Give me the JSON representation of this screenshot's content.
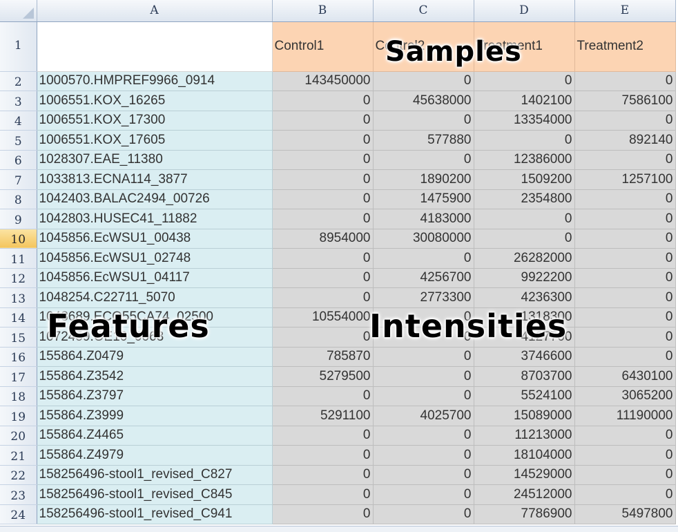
{
  "columns": [
    "A",
    "B",
    "C",
    "D",
    "E"
  ],
  "header_row": {
    "number": "1",
    "a": "",
    "labels": [
      "Control1",
      "Control2",
      "Treatment1",
      "Treatment2"
    ]
  },
  "rows": [
    {
      "n": "2",
      "feature": "1000570.HMPREF9966_0914",
      "vals": [
        "143450000",
        "0",
        "0",
        "0"
      ]
    },
    {
      "n": "3",
      "feature": "1006551.KOX_16265",
      "vals": [
        "0",
        "45638000",
        "1402100",
        "7586100"
      ]
    },
    {
      "n": "4",
      "feature": "1006551.KOX_17300",
      "vals": [
        "0",
        "0",
        "13354000",
        "0"
      ]
    },
    {
      "n": "5",
      "feature": "1006551.KOX_17605",
      "vals": [
        "0",
        "577880",
        "0",
        "892140"
      ]
    },
    {
      "n": "6",
      "feature": "1028307.EAE_11380",
      "vals": [
        "0",
        "0",
        "12386000",
        "0"
      ]
    },
    {
      "n": "7",
      "feature": "1033813.ECNA114_3877",
      "vals": [
        "0",
        "1890200",
        "1509200",
        "1257100"
      ]
    },
    {
      "n": "8",
      "feature": "1042403.BALAC2494_00726",
      "vals": [
        "0",
        "1475900",
        "2354800",
        "0"
      ]
    },
    {
      "n": "9",
      "feature": "1042803.HUSEC41_11882",
      "vals": [
        "0",
        "4183000",
        "0",
        "0"
      ]
    },
    {
      "n": "10",
      "feature": "1045856.EcWSU1_00438",
      "vals": [
        "8954000",
        "30080000",
        "0",
        "0"
      ]
    },
    {
      "n": "11",
      "feature": "1045856.EcWSU1_02748",
      "vals": [
        "0",
        "0",
        "26282000",
        "0"
      ]
    },
    {
      "n": "12",
      "feature": "1045856.EcWSU1_04117",
      "vals": [
        "0",
        "4256700",
        "9922200",
        "0"
      ]
    },
    {
      "n": "13",
      "feature": "1048254.C22711_5070",
      "vals": [
        "0",
        "2773300",
        "4236300",
        "0"
      ]
    },
    {
      "n": "14",
      "feature": "1048689.ECO55CA74_02500",
      "vals": [
        "10554000",
        "0",
        "1318300",
        "0"
      ]
    },
    {
      "n": "15",
      "feature": "1072459.OE10_0063",
      "vals": [
        "0",
        "0",
        "4127700",
        "0"
      ]
    },
    {
      "n": "16",
      "feature": "155864.Z0479",
      "vals": [
        "785870",
        "0",
        "3746600",
        "0"
      ]
    },
    {
      "n": "17",
      "feature": "155864.Z3542",
      "vals": [
        "5279500",
        "0",
        "8703700",
        "6430100"
      ]
    },
    {
      "n": "18",
      "feature": "155864.Z3797",
      "vals": [
        "0",
        "0",
        "5524100",
        "3065200"
      ]
    },
    {
      "n": "19",
      "feature": "155864.Z3999",
      "vals": [
        "5291100",
        "4025700",
        "15089000",
        "11190000"
      ]
    },
    {
      "n": "20",
      "feature": "155864.Z4465",
      "vals": [
        "0",
        "0",
        "11213000",
        "0"
      ]
    },
    {
      "n": "21",
      "feature": "155864.Z4979",
      "vals": [
        "0",
        "0",
        "18104000",
        "0"
      ]
    },
    {
      "n": "22",
      "feature": "158256496-stool1_revised_C827",
      "vals": [
        "0",
        "0",
        "14529000",
        "0"
      ]
    },
    {
      "n": "23",
      "feature": "158256496-stool1_revised_C845",
      "vals": [
        "0",
        "0",
        "24512000",
        "0"
      ]
    },
    {
      "n": "24",
      "feature": "158256496-stool1_revised_C941",
      "vals": [
        "0",
        "0",
        "7786900",
        "5497800"
      ]
    }
  ],
  "active_row": "10",
  "overlays": {
    "samples": "Samples",
    "features": "Features",
    "intensities": "Intensities"
  },
  "colors": {
    "header_fill": "#fcd4b3",
    "feature_fill": "#daeef2",
    "value_fill": "#d9d9d9",
    "active_row_header": "#f4c55d"
  }
}
